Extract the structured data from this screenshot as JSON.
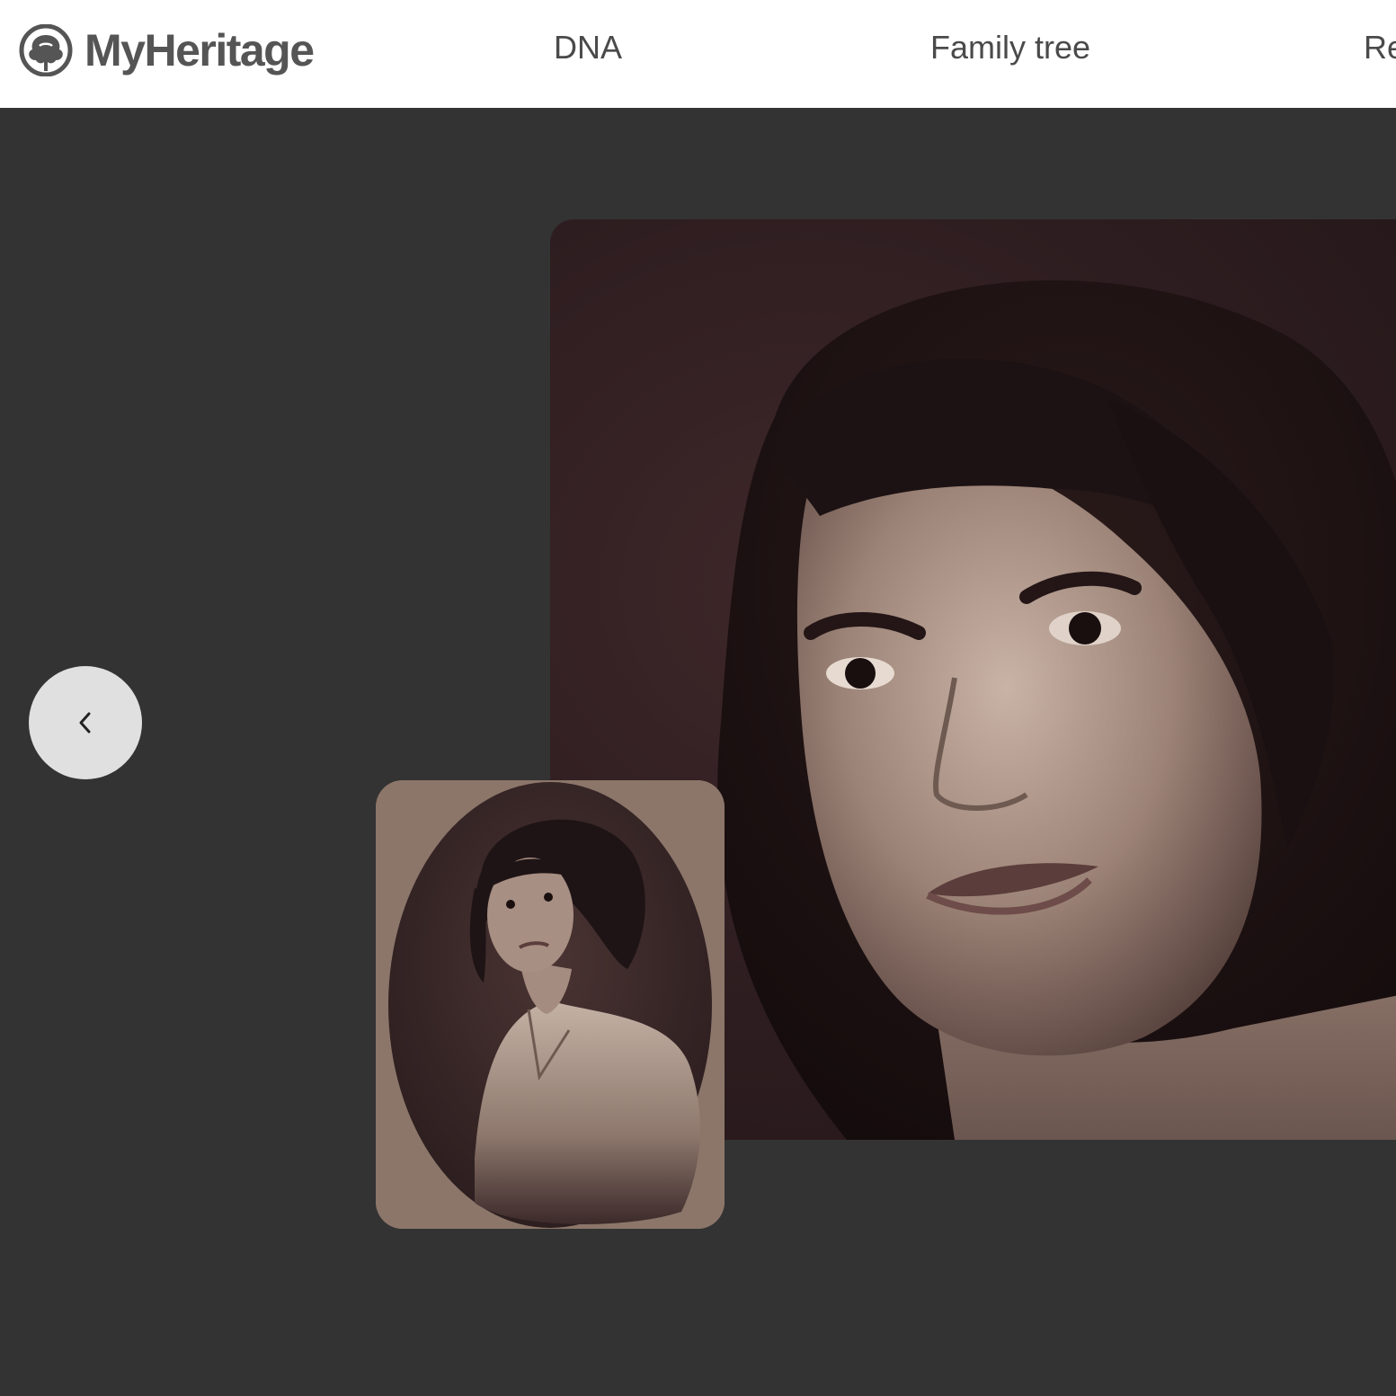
{
  "header": {
    "logo": {
      "text": "MyHeritage",
      "icon": "myheritage-tree-icon"
    },
    "nav": [
      {
        "label": "DNA"
      },
      {
        "label": "Family tree"
      },
      {
        "label": "Re"
      }
    ]
  },
  "viewer": {
    "prev_icon": "chevron-left-icon",
    "large_photo": "enhanced-portrait-closeup",
    "small_photo": "original-oval-portrait"
  },
  "colors": {
    "header_bg": "#ffffff",
    "stage_bg": "#333333",
    "nav_text": "#4a4a4a",
    "logo_text": "#555555",
    "button_bg": "#e0e0e0"
  }
}
